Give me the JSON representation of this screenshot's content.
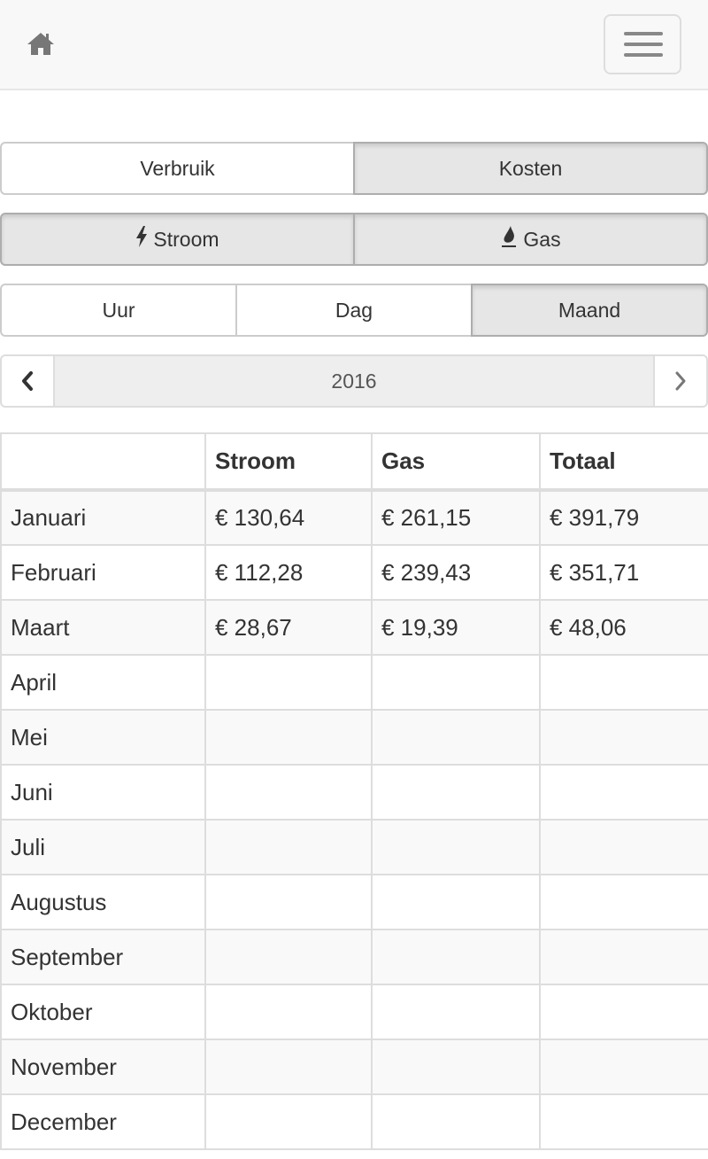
{
  "navbar": {
    "home_icon": "home-icon",
    "menu_icon": "hamburger-menu-icon"
  },
  "mode_toggle": [
    {
      "label": "Verbruik",
      "active": false
    },
    {
      "label": "Kosten",
      "active": true
    }
  ],
  "energy_toggle": [
    {
      "label": "Stroom",
      "icon": "bolt-icon",
      "active": true
    },
    {
      "label": "Gas",
      "icon": "flame-icon",
      "active": true
    }
  ],
  "period_toggle": [
    {
      "label": "Uur",
      "active": false
    },
    {
      "label": "Dag",
      "active": false
    },
    {
      "label": "Maand",
      "active": true
    }
  ],
  "pager": {
    "year": "2016",
    "prev_icon": "chevron-left-icon",
    "next_icon": "chevron-right-icon"
  },
  "table": {
    "headers": [
      "",
      "Stroom",
      "Gas",
      "Totaal"
    ],
    "rows": [
      {
        "month": "Januari",
        "stroom": "€ 130,64",
        "gas": "€ 261,15",
        "totaal": "€ 391,79"
      },
      {
        "month": "Februari",
        "stroom": "€ 112,28",
        "gas": "€ 239,43",
        "totaal": "€ 351,71"
      },
      {
        "month": "Maart",
        "stroom": "€ 28,67",
        "gas": "€ 19,39",
        "totaal": "€ 48,06"
      },
      {
        "month": "April",
        "stroom": "",
        "gas": "",
        "totaal": ""
      },
      {
        "month": "Mei",
        "stroom": "",
        "gas": "",
        "totaal": ""
      },
      {
        "month": "Juni",
        "stroom": "",
        "gas": "",
        "totaal": ""
      },
      {
        "month": "Juli",
        "stroom": "",
        "gas": "",
        "totaal": ""
      },
      {
        "month": "Augustus",
        "stroom": "",
        "gas": "",
        "totaal": ""
      },
      {
        "month": "September",
        "stroom": "",
        "gas": "",
        "totaal": ""
      },
      {
        "month": "Oktober",
        "stroom": "",
        "gas": "",
        "totaal": ""
      },
      {
        "month": "November",
        "stroom": "",
        "gas": "",
        "totaal": ""
      },
      {
        "month": "December",
        "stroom": "",
        "gas": "",
        "totaal": ""
      }
    ]
  }
}
